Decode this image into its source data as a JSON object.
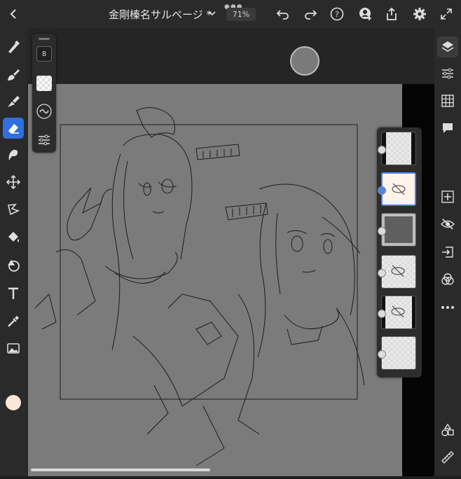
{
  "topbar": {
    "title": "金剛榛名サルベージ *",
    "zoom": "71%",
    "icons": [
      "back-icon",
      "more-dots-icon",
      "chevron-down-icon",
      "undo-icon",
      "redo-icon",
      "help-icon",
      "add-user-icon",
      "share-icon",
      "settings-icon",
      "fullscreen-icon"
    ]
  },
  "tools": {
    "brush_size": "8",
    "items": [
      "pixel-brush",
      "live-brush",
      "vector-brush",
      "eraser",
      "smudge",
      "move",
      "lasso",
      "fill",
      "shape",
      "text",
      "eyedropper",
      "image"
    ],
    "active": "eraser",
    "color": "#fbe6d8"
  },
  "right_tools": [
    "layers",
    "layer-properties",
    "grid",
    "comments",
    "add-layer",
    "visibility",
    "import",
    "blend",
    "more"
  ],
  "layers": [
    {
      "name": "layer-1",
      "state": "visible"
    },
    {
      "name": "layer-2",
      "state": "hidden-selected"
    },
    {
      "name": "layer-3",
      "state": "visible"
    },
    {
      "name": "layer-4",
      "state": "hidden"
    },
    {
      "name": "layer-5",
      "state": "hidden"
    },
    {
      "name": "layer-6",
      "state": "visible"
    }
  ]
}
